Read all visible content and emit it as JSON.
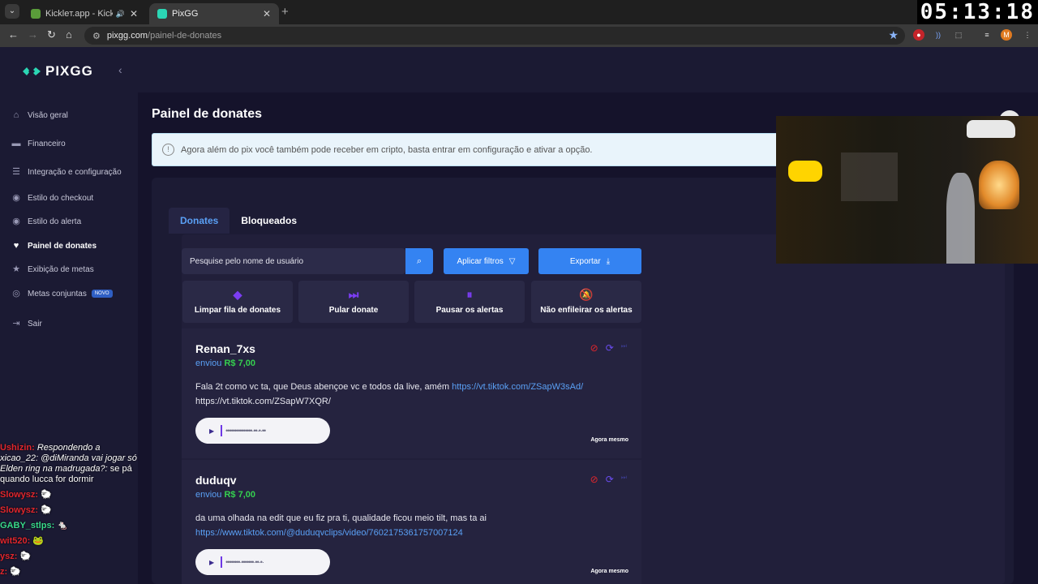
{
  "browser": {
    "tabs": [
      {
        "title": "Kickleт.app - Kick Chatbot a",
        "active": false
      },
      {
        "title": "PixGG",
        "active": true
      }
    ],
    "url_host": "pixgg.com",
    "url_path": "/painel-de-donates",
    "clock": "05:13:18",
    "profile_initial": "M"
  },
  "sidebar": {
    "logo": "PIXGG",
    "items": [
      {
        "label": "Visão geral",
        "icon": "home-icon"
      },
      {
        "label": "Financeiro",
        "icon": "wallet-icon"
      },
      {
        "label": "Integração e configuração",
        "icon": "settings-icon"
      },
      {
        "label": "Estilo do checkout",
        "icon": "palette-icon"
      },
      {
        "label": "Estilo do alerta",
        "icon": "palette-icon"
      },
      {
        "label": "Painel de donates",
        "icon": "donate-icon",
        "active": true
      },
      {
        "label": "Exibição de metas",
        "icon": "star-icon"
      },
      {
        "label": "Metas conjuntas",
        "icon": "target-icon",
        "badge": "NOVO"
      },
      {
        "label": "Sair",
        "icon": "logout-icon"
      }
    ]
  },
  "chat": [
    {
      "user": "Ushizin:",
      "color": "#e0262d",
      "reply": "Respondendo a xicao_22: @diMiranda vai jogar só Elden ring na madrugada?:",
      "text": "se pá quando lucca for dormir"
    },
    {
      "user": "Slowysz:",
      "color": "#e0262d",
      "text": "🐑"
    },
    {
      "user": "Slowysz:",
      "color": "#e0262d",
      "text": "🐑"
    },
    {
      "user": "GABY_stlps:",
      "color": "#38d98a",
      "text": "🐁"
    },
    {
      "user": "wit520:",
      "color": "#e0262d",
      "text": "🐸"
    },
    {
      "user": "ysz:",
      "color": "#e0262d",
      "text": "🐑"
    },
    {
      "user": "z:",
      "color": "#e0262d",
      "text": "🐑"
    }
  ],
  "main": {
    "title": "Painel de donates",
    "alert": "Agora além do pix você também pode receber em cripto, basta entrar em configuração e ativar a opção.",
    "tabs": [
      "Donates",
      "Bloqueados"
    ],
    "search_placeholder": "Pesquise pelo nome de usuário",
    "filter_label": "Aplicar filtros",
    "export_label": "Exportar",
    "actions": [
      {
        "label": "Limpar fila de donates",
        "icon": "eraser-icon"
      },
      {
        "label": "Pular donate",
        "icon": "skip-icon"
      },
      {
        "label": "Pausar os alertas",
        "icon": "pause-icon"
      },
      {
        "label": "Não enfileirar os alertas",
        "icon": "bell-off-icon"
      }
    ],
    "donations": [
      {
        "name": "Renan_7xs",
        "sent": "enviou",
        "amount": "R$ 7,00",
        "message": "Fala 2t como vc ta, que Deus abençoe vc e todos da live, amém",
        "link": "https://vt.tiktok.com/ZSapW3sAd/",
        "message2": "https://vt.tiktok.com/ZSapW7XQR/",
        "time": "Agora mesmo"
      },
      {
        "name": "duduqv",
        "sent": "enviou",
        "amount": "R$ 7,00",
        "message": "da uma olhada na edit que eu fiz pra ti, qualidade ficou meio tilt, mas ta ai",
        "link": "https://www.tiktok.com/@duduqvclips/video/7602175361757007124",
        "time": "Agora mesmo"
      }
    ]
  },
  "colors": {
    "accent": "#3483f2",
    "amount": "#35d04f",
    "link": "#5aa0f5",
    "action_icon": "#7b3df3",
    "block_icon": "#e0262d"
  }
}
